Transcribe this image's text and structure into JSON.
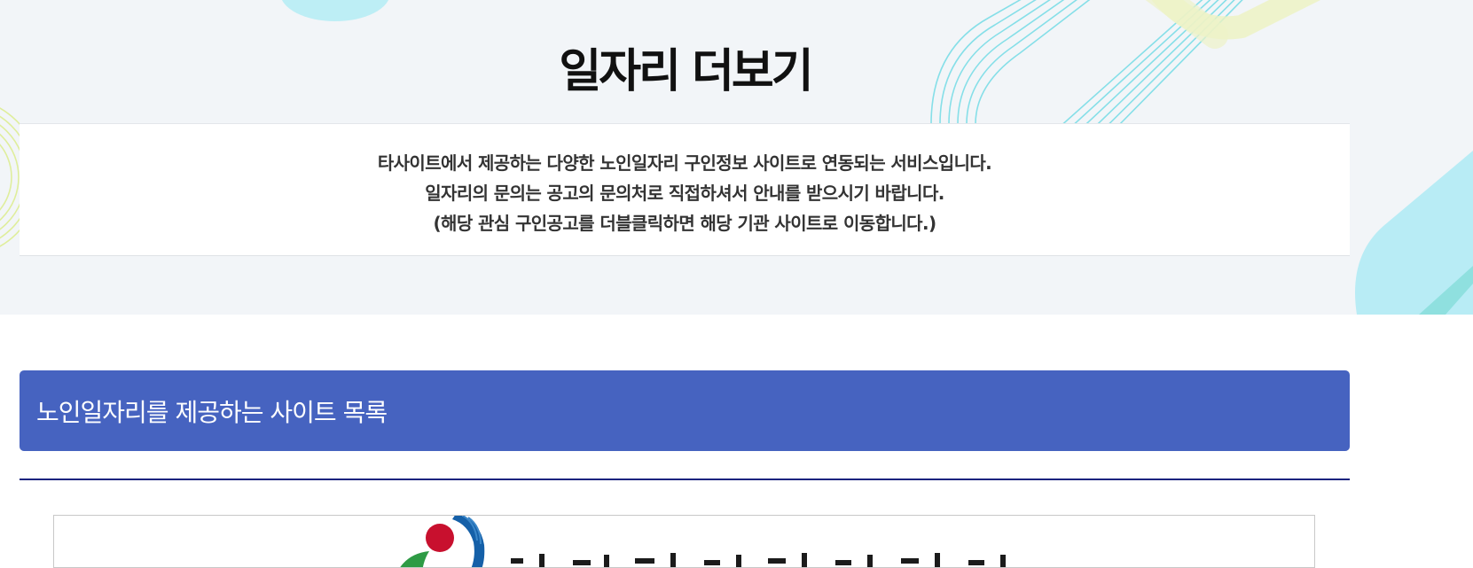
{
  "page": {
    "title": "일자리 더보기"
  },
  "notice": {
    "lines": [
      "타사이트에서 제공하는 다양한 노인일자리 구인정보 사이트로 연동되는 서비스입니다.",
      "일자리의 문의는 공고의 문의처로 직접하셔서 안내를 받으시기 바랍니다.",
      "(해당 관심 구인공고를 더블클릭하면 해당 기관 사이트로 이동합니다.)"
    ]
  },
  "site_list": {
    "heading": "노인일자리를 제공하는 사이트 목록"
  },
  "colors": {
    "hero_background": "#f2f5f8",
    "list_header": "#4663c0",
    "divider": "#1a237e",
    "deco_cyan": "#7fd8ea",
    "deco_yellow": "#e8efb0"
  },
  "icons": {
    "site_logo": "government-emblem-logo"
  }
}
